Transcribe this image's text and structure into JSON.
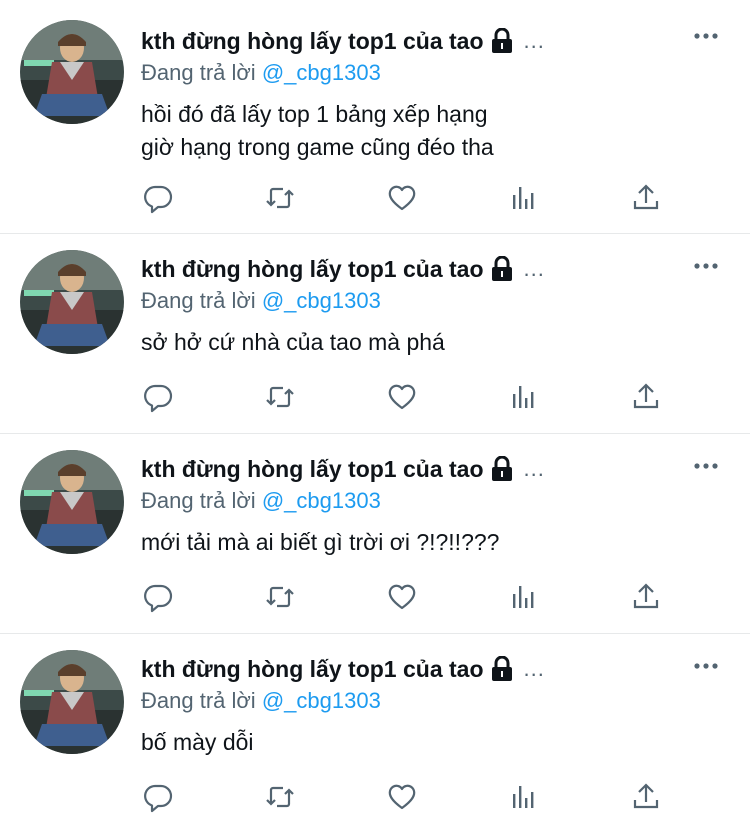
{
  "tweets": [
    {
      "name": "kth đừng hòng lấy top1 của tao",
      "truncation": "...",
      "reply_prefix": "Đang trả lời",
      "reply_handle": "@_cbg1303",
      "text_lines": [
        "hồi đó đã lấy top 1 bảng xếp hạng",
        "giờ hạng trong game cũng đéo tha"
      ]
    },
    {
      "name": "kth đừng hòng lấy top1 của tao",
      "truncation": "...",
      "reply_prefix": "Đang trả lời",
      "reply_handle": "@_cbg1303",
      "text_lines": [
        "sở hở cứ nhà của tao mà phá"
      ]
    },
    {
      "name": "kth đừng hòng lấy top1 của tao",
      "truncation": "...",
      "reply_prefix": "Đang trả lời",
      "reply_handle": "@_cbg1303",
      "text_lines": [
        "mới tải mà ai biết gì trời ơi ?!?!!???"
      ]
    },
    {
      "name": "kth đừng hòng lấy top1 của tao",
      "truncation": "...",
      "reply_prefix": "Đang trả lời",
      "reply_handle": "@_cbg1303",
      "text_lines": [
        "bố mày dỗi"
      ]
    }
  ],
  "icons": {
    "lock": "lock-icon",
    "more": "more-options-icon",
    "reply": "reply-icon",
    "retweet": "retweet-icon",
    "like": "heart-icon",
    "views": "analytics-icon",
    "share": "share-icon"
  },
  "colors": {
    "text": "#0f1419",
    "secondary": "#536471",
    "handle": "#1d9bf0",
    "divider": "#e7e9ea"
  }
}
